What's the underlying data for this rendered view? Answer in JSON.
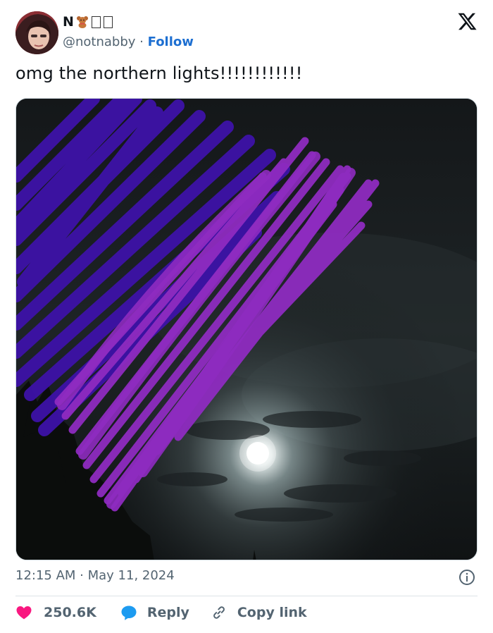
{
  "colors": {
    "heart": "#f91880",
    "reply_bubble": "#1d9bf0",
    "follow": "#1d6fd1",
    "scribble_dark": "#3d12a8",
    "scribble_light": "#8e2bc0"
  },
  "user": {
    "display_name": "N",
    "handle": "@notnabby",
    "separator": "·",
    "follow_label": "Follow"
  },
  "tweet": {
    "text": "omg the northern lights!!!!!!!!!!!!",
    "time": "12:15 AM",
    "date": "May 11, 2024",
    "meta_separator": " · "
  },
  "actions": {
    "like_count": "250.6K",
    "reply_label": "Reply",
    "copy_label": "Copy link"
  },
  "icons": {
    "brand": "x-logo-icon",
    "info": "info-icon",
    "like": "heart-icon",
    "reply": "speech-bubble-icon",
    "copy": "link-icon",
    "emoji": "teddy-bear-icon"
  }
}
